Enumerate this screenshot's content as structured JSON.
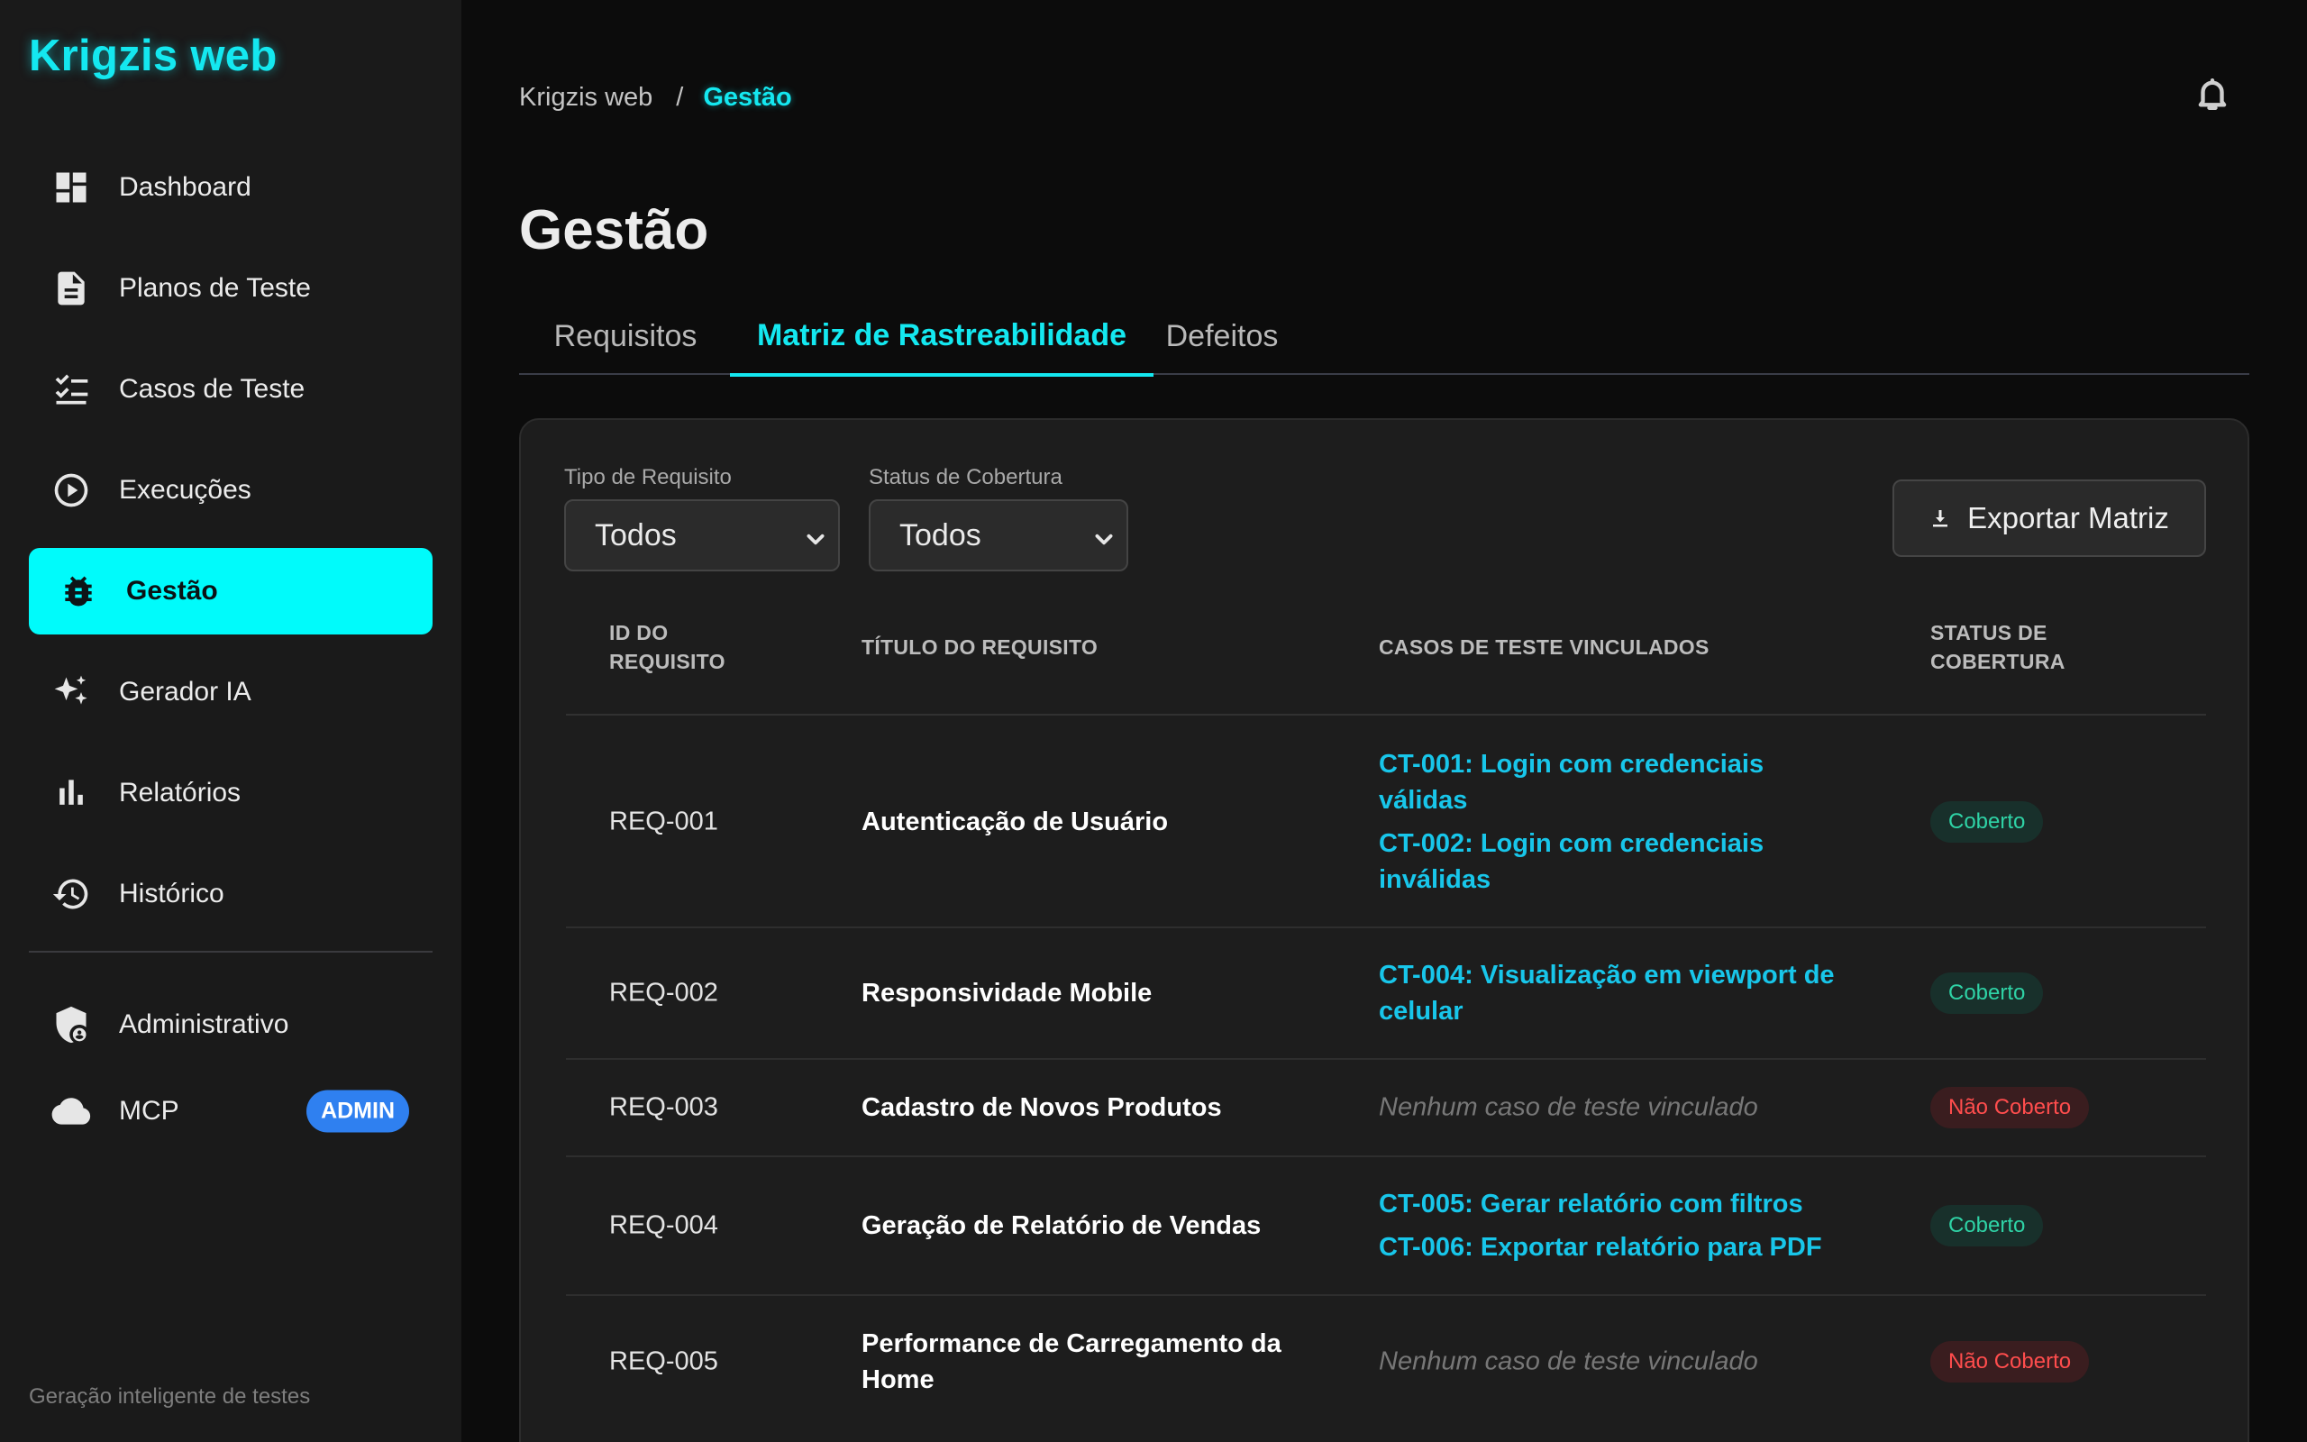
{
  "app": {
    "brand": "Krigzis web",
    "tagline": "Geração inteligente de testes"
  },
  "sidebar": {
    "items": [
      {
        "label": "Dashboard",
        "icon": "dashboard-icon"
      },
      {
        "label": "Planos de Teste",
        "icon": "document-icon"
      },
      {
        "label": "Casos de Teste",
        "icon": "checklist-icon"
      },
      {
        "label": "Execuções",
        "icon": "play-circle-icon"
      },
      {
        "label": "Gestão",
        "icon": "bug-icon",
        "active": true
      },
      {
        "label": "Gerador IA",
        "icon": "sparkle-icon"
      },
      {
        "label": "Relatórios",
        "icon": "bar-chart-icon"
      },
      {
        "label": "Histórico",
        "icon": "history-icon"
      }
    ],
    "admin_items": [
      {
        "label": "Administrativo",
        "icon": "admin-shield-icon"
      },
      {
        "label": "MCP",
        "icon": "cloud-icon",
        "badge": "ADMIN"
      }
    ]
  },
  "breadcrumb": {
    "root": "Krigzis web",
    "separator": "/",
    "current": "Gestão"
  },
  "page": {
    "title": "Gestão"
  },
  "tabs": [
    {
      "label": "Requisitos"
    },
    {
      "label": "Matriz de Rastreabilidade",
      "active": true
    },
    {
      "label": "Defeitos"
    }
  ],
  "filters": {
    "type": {
      "label": "Tipo de Requisito",
      "value": "Todos"
    },
    "coverage": {
      "label": "Status de Cobertura",
      "value": "Todos"
    }
  },
  "export_label": "Exportar Matriz",
  "table": {
    "headers": {
      "id_line1": "ID DO",
      "id_line2": "REQUISITO",
      "title": "TÍTULO DO REQUISITO",
      "cases": "CASOS DE TESTE VINCULADOS",
      "status_line1": "STATUS DE",
      "status_line2": "COBERTURA"
    },
    "rows": [
      {
        "id": "REQ-001",
        "title": "Autenticação de Usuário",
        "cases": [
          "CT-001: Login com credenciais válidas",
          "CT-002: Login com credenciais inválidas"
        ],
        "status": "Coberto"
      },
      {
        "id": "REQ-002",
        "title": "Responsividade Mobile",
        "cases": [
          "CT-004: Visualização em viewport de celular"
        ],
        "status": "Coberto"
      },
      {
        "id": "REQ-003",
        "title": "Cadastro de Novos Produtos",
        "cases_empty": "Nenhum caso de teste vinculado",
        "status": "Não Coberto"
      },
      {
        "id": "REQ-004",
        "title": "Geração de Relatório de Vendas",
        "cases": [
          "CT-005: Gerar relatório com filtros",
          "CT-006: Exportar relatório para PDF"
        ],
        "status": "Coberto"
      },
      {
        "id": "REQ-005",
        "title": "Performance de Carregamento da Home",
        "cases_empty": "Nenhum caso de teste vinculado",
        "status": "Não Coberto"
      }
    ]
  },
  "colors": {
    "accent": "#00fbfb",
    "link": "#18c6ea",
    "covered": "#2fd3a6",
    "not_covered": "#ff4d4d",
    "badge_admin": "#2f80f0"
  }
}
